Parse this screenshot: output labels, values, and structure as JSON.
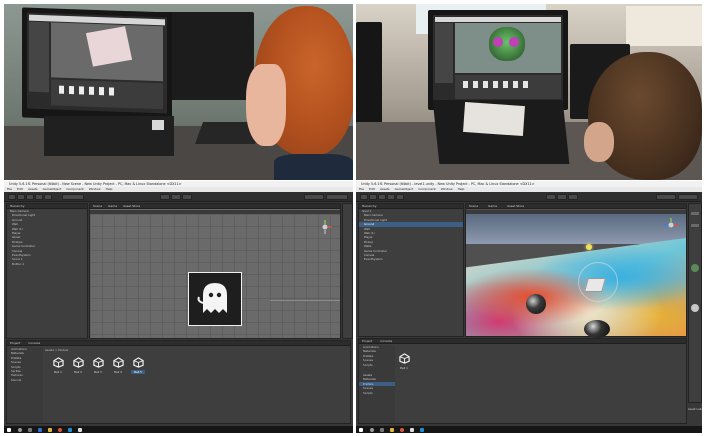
{
  "photos": {
    "top_left": {
      "description_icon": "student-at-computer-photo"
    },
    "top_right": {
      "description_icon": "student-at-computer-photo"
    }
  },
  "editor_left": {
    "title": "Unity 5.6.1f1 Personal (64bit) - New Scene - New Unity Project - PC, Mac & Linux Standalone <DX11>",
    "menu": [
      "File",
      "Edit",
      "Assets",
      "GameObject",
      "Component",
      "Window",
      "Help"
    ],
    "hierarchy": {
      "tab": "Hierarchy",
      "items": [
        "Main Camera",
        "Directional Light",
        "Ground",
        "Wall",
        "Wall (1)",
        "Player",
        "Ghost",
        "Pickups",
        "Game Controller",
        "Canvas",
        "EventSystem",
        "Score 1",
        "Button 1"
      ]
    },
    "scene_tabs": [
      "Scene",
      "Game",
      "Asset Store"
    ],
    "project": {
      "tabs": [
        "Project",
        "Console"
      ],
      "folders": [
        "Animations",
        "Materials",
        "Prefabs",
        "Scenes",
        "Scripts",
        "Sprites",
        "Textures",
        "Sounds"
      ],
      "breadcrumb": "Assets > Models",
      "assets": [
        "Ball 1",
        "Ball 2",
        "Ball 3",
        "Ball 4",
        "Ball 5"
      ]
    },
    "colors": {
      "selection": "#3d5f86",
      "scene_bg": "#6b6b6b"
    }
  },
  "editor_right": {
    "title": "Unity 5.6.1f1 Personal (64bit) - level1.unity - New Unity Project - PC, Mac & Linux Standalone <DX11>",
    "menu": [
      "File",
      "Edit",
      "Assets",
      "GameObject",
      "Component",
      "Window",
      "Help"
    ],
    "hierarchy": {
      "tab": "Hierarchy",
      "items": [
        "level 1",
        "Main Camera",
        "Directional Light",
        "Ground",
        "Wall",
        "Wall (1)",
        "Player",
        "Pickup",
        "Walls",
        "Game Controller",
        "Canvas",
        "EventSystem"
      ]
    },
    "scene_tabs": [
      "Scene",
      "Game",
      "Asset Store"
    ],
    "project": {
      "tabs": [
        "Project",
        "Console"
      ],
      "folders": [
        "Animations",
        "Materials",
        "Prefabs",
        "Scenes",
        "Scripts"
      ],
      "lower_folders": [
        "Assets",
        "Materials",
        "Prefabs",
        "Scenes",
        "Scripts"
      ],
      "asset": "Ball 1"
    },
    "side_text": "Asset Labe",
    "colors": {
      "selection": "#3d5f86"
    }
  }
}
